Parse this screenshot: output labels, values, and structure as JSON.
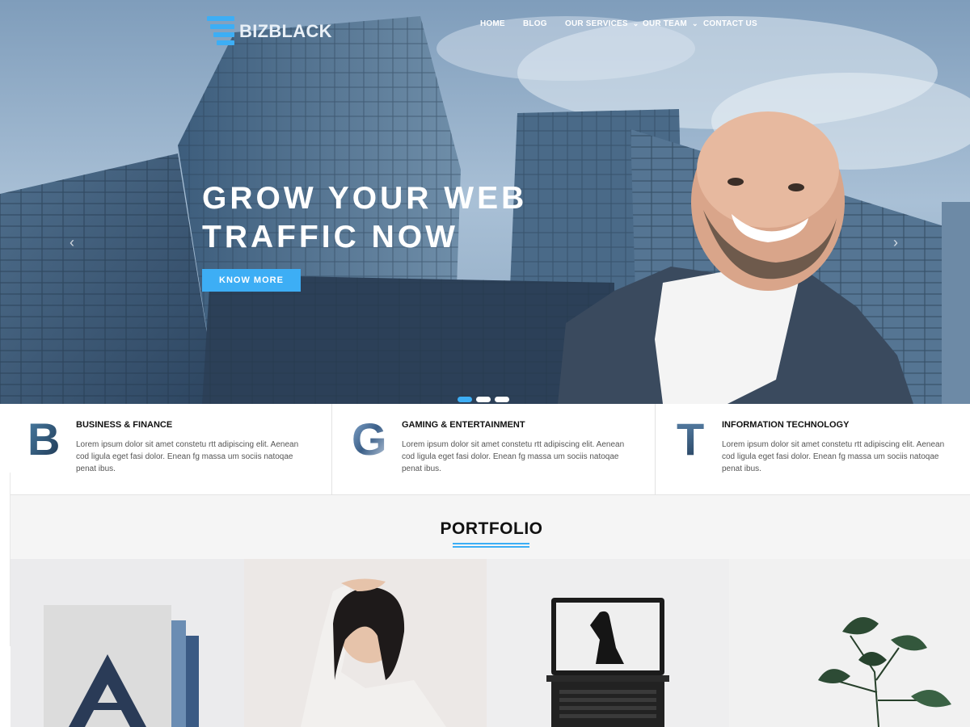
{
  "brand": {
    "name": "BIZBLACK",
    "accent": "#3daef5"
  },
  "nav": [
    {
      "label": "HOME",
      "dropdown": false
    },
    {
      "label": "BLOG",
      "dropdown": false
    },
    {
      "label": "OUR SERVICES",
      "dropdown": true
    },
    {
      "label": "OUR TEAM",
      "dropdown": true
    },
    {
      "label": "CONTACT US",
      "dropdown": false
    }
  ],
  "hero": {
    "title_line1": "GROW YOUR WEB",
    "title_line2": "TRAFFIC NOW",
    "button": "KNOW MORE",
    "prev_icon": "chevron-left-icon",
    "next_icon": "chevron-right-icon",
    "slides": 3,
    "active_slide": 1
  },
  "features": [
    {
      "letter": "B",
      "title": "BUSINESS & FINANCE",
      "text": "Lorem ipsum dolor sit amet constetu rtt adipiscing elit. Aenean cod ligula eget fasi dolor. Enean fg massa um sociis natoqae penat ibus."
    },
    {
      "letter": "G",
      "title": "GAMING & ENTERTAINMENT",
      "text": "Lorem ipsum dolor sit amet constetu rtt adipiscing elit. Aenean cod ligula eget fasi dolor. Enean fg massa um sociis natoqae penat ibus."
    },
    {
      "letter": "T",
      "title": "INFORMATION TECHNOLOGY",
      "text": "Lorem ipsum dolor sit amet constetu rtt adipiscing elit. Aenean cod ligula eget fasi dolor. Enean fg massa um sociis natoqae penat ibus."
    }
  ],
  "portfolio": {
    "title": "PORTFOLIO",
    "items": [
      "letter-a-artwork",
      "woman-portrait",
      "laptop-dancer",
      "potted-plant"
    ]
  }
}
